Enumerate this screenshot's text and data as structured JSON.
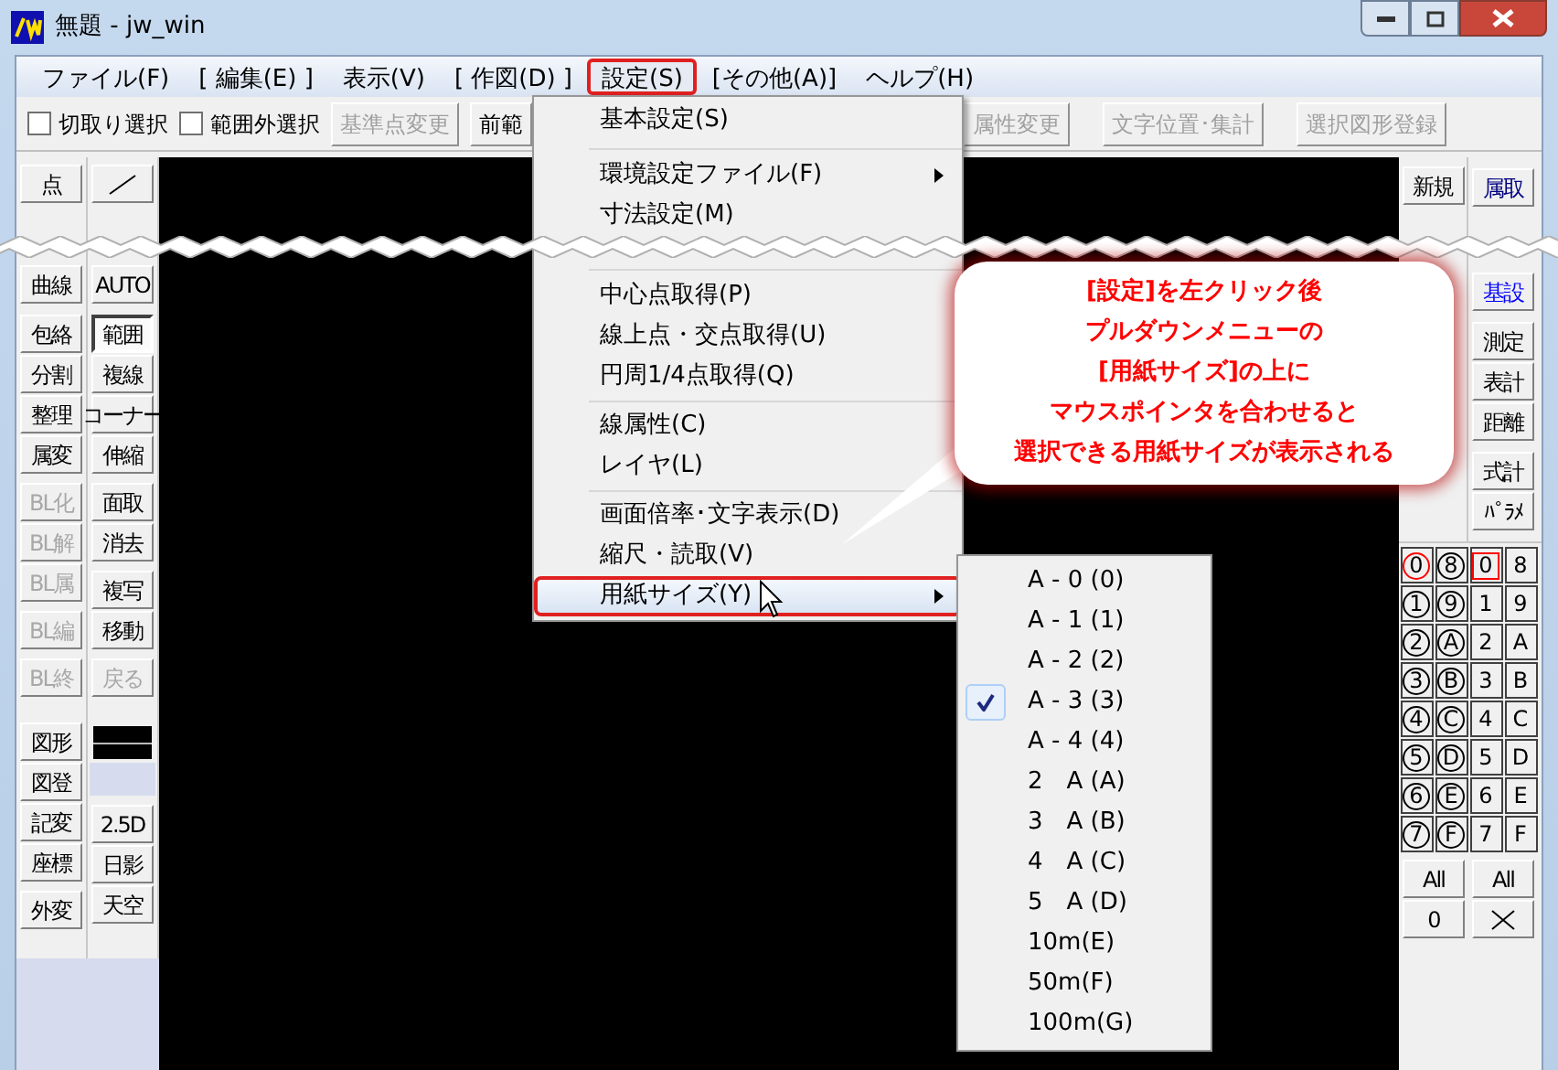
{
  "window": {
    "title": "無題 - jw_win"
  },
  "menu_bar": [
    {
      "label": "ファイル(F)",
      "selected": false
    },
    {
      "label": "[ 編集(E) ]",
      "selected": false
    },
    {
      "label": "表示(V)",
      "selected": false
    },
    {
      "label": "[ 作図(D) ]",
      "selected": false
    },
    {
      "label": "設定(S)",
      "selected": true
    },
    {
      "label": "[その他(A)]",
      "selected": false
    },
    {
      "label": "ヘルプ(H)",
      "selected": false
    }
  ],
  "toolbar": {
    "checkboxes": [
      {
        "label": "切取り選択",
        "checked": false
      },
      {
        "label": "範囲外選択",
        "checked": false
      }
    ],
    "buttons": [
      {
        "label": "基準点変更",
        "disabled": true
      },
      {
        "label": "前範",
        "disabled": false
      },
      {
        "label": "属性変更",
        "disabled": true
      },
      {
        "label": "文字位置･集計",
        "disabled": true
      },
      {
        "label": "選択図形登録",
        "disabled": true
      }
    ]
  },
  "left_panel": {
    "columns": [
      [
        [
          {
            "label": "点",
            "disabled": false,
            "pressed": false
          }
        ],
        [
          {
            "label": "曲線",
            "disabled": false,
            "pressed": false
          }
        ],
        [
          {
            "label": "包絡",
            "disabled": false,
            "pressed": false
          },
          {
            "label": "分割",
            "disabled": false,
            "pressed": false
          },
          {
            "label": "整理",
            "disabled": false,
            "pressed": false
          },
          {
            "label": "属変",
            "disabled": false,
            "pressed": false
          }
        ],
        [
          {
            "label": "BL化",
            "disabled": true,
            "pressed": false
          },
          {
            "label": "BL解",
            "disabled": true,
            "pressed": false
          },
          {
            "label": "BL属",
            "disabled": true,
            "pressed": false
          }
        ],
        [
          {
            "label": "BL編",
            "disabled": true,
            "pressed": false
          }
        ],
        [
          {
            "label": "BL終",
            "disabled": true,
            "pressed": false
          }
        ],
        [
          {
            "label": "図形",
            "disabled": false,
            "pressed": false
          },
          {
            "label": "図登",
            "disabled": false,
            "pressed": false
          },
          {
            "label": "記変",
            "disabled": false,
            "pressed": false
          },
          {
            "label": "座標",
            "disabled": false,
            "pressed": false
          }
        ],
        [
          {
            "label": "外変",
            "disabled": false,
            "pressed": false
          }
        ]
      ],
      [
        [
          {
            "kind": "line"
          }
        ],
        [
          {
            "label": "AUTO",
            "disabled": false,
            "pressed": false
          }
        ],
        [
          {
            "label": "範囲",
            "disabled": false,
            "pressed": true
          },
          {
            "label": "複線",
            "disabled": false,
            "pressed": false
          },
          {
            "label": "コーナー",
            "disabled": false,
            "pressed": false
          },
          {
            "label": "伸縮",
            "disabled": false,
            "pressed": false
          }
        ],
        [
          {
            "label": "面取",
            "disabled": false,
            "pressed": false
          },
          {
            "label": "消去",
            "disabled": false,
            "pressed": false
          }
        ],
        [
          {
            "label": "複写",
            "disabled": false,
            "pressed": false
          },
          {
            "label": "移動",
            "disabled": false,
            "pressed": false
          }
        ],
        [
          {
            "label": "戻る",
            "disabled": true,
            "pressed": false
          }
        ],
        [
          {
            "kind": "swatch"
          }
        ],
        [
          {
            "label": "2.5D",
            "disabled": false,
            "pressed": false
          },
          {
            "label": "日影",
            "disabled": false,
            "pressed": false
          },
          {
            "label": "天空",
            "disabled": false,
            "pressed": false
          }
        ]
      ]
    ]
  },
  "right_panel": {
    "column_1": [
      {
        "label": "新規",
        "color": "#000000"
      }
    ],
    "column_2": [
      {
        "label": "属取",
        "color": "#000080"
      },
      {
        "label": "基設",
        "color": "#0000ff"
      },
      {
        "label": "測定",
        "color": "#000000"
      },
      {
        "label": "表計",
        "color": "#000000"
      },
      {
        "label": "距離",
        "color": "#000000"
      },
      {
        "label": "式計",
        "color": "#000000"
      },
      {
        "label": "ﾊﾟﾗﾒ",
        "color": "#000000"
      }
    ],
    "layer_groups": [
      {
        "label": "0",
        "selected": true
      },
      {
        "label": "1",
        "selected": false
      },
      {
        "label": "2",
        "selected": false
      },
      {
        "label": "3",
        "selected": false
      },
      {
        "label": "4",
        "selected": false
      },
      {
        "label": "5",
        "selected": false
      },
      {
        "label": "6",
        "selected": false
      },
      {
        "label": "7",
        "selected": false
      },
      {
        "label": "8",
        "selected": false
      },
      {
        "label": "9",
        "selected": false
      },
      {
        "label": "A",
        "selected": false
      },
      {
        "label": "B",
        "selected": false
      },
      {
        "label": "C",
        "selected": false
      },
      {
        "label": "D",
        "selected": false
      },
      {
        "label": "E",
        "selected": false
      },
      {
        "label": "F",
        "selected": false
      }
    ],
    "layers": [
      {
        "label": "0",
        "selected": true
      },
      {
        "label": "1",
        "selected": false
      },
      {
        "label": "2",
        "selected": false
      },
      {
        "label": "3",
        "selected": false
      },
      {
        "label": "4",
        "selected": false
      },
      {
        "label": "5",
        "selected": false
      },
      {
        "label": "6",
        "selected": false
      },
      {
        "label": "7",
        "selected": false
      },
      {
        "label": "8",
        "selected": false
      },
      {
        "label": "9",
        "selected": false
      },
      {
        "label": "A",
        "selected": false
      },
      {
        "label": "B",
        "selected": false
      },
      {
        "label": "C",
        "selected": false
      },
      {
        "label": "D",
        "selected": false
      },
      {
        "label": "E",
        "selected": false
      },
      {
        "label": "F",
        "selected": false
      }
    ],
    "group_buttons": [
      "All",
      "0"
    ],
    "layer_buttons": [
      "All"
    ]
  },
  "settings_menu": [
    [
      {
        "label": "基本設定(S)",
        "submenu": false,
        "highlighted": false
      }
    ],
    [
      {
        "label": "環境設定ファイル(F)",
        "submenu": true,
        "highlighted": false
      },
      {
        "label": "寸法設定(M)",
        "submenu": false,
        "highlighted": false
      }
    ],
    [
      {
        "label": "中心点取得(P)",
        "submenu": false,
        "highlighted": false
      },
      {
        "label": "線上点・交点取得(U)",
        "submenu": false,
        "highlighted": false
      },
      {
        "label": "円周1/4点取得(Q)",
        "submenu": false,
        "highlighted": false
      }
    ],
    [
      {
        "label": "線属性(C)",
        "submenu": false,
        "highlighted": false
      },
      {
        "label": "レイヤ(L)",
        "submenu": false,
        "highlighted": false
      }
    ],
    [
      {
        "label": "画面倍率･文字表示(D)",
        "submenu": false,
        "highlighted": false
      },
      {
        "label": "縮尺・読取(V)",
        "submenu": false,
        "highlighted": false
      },
      {
        "label": "用紙サイズ(Y)",
        "submenu": true,
        "highlighted": true
      }
    ]
  ],
  "paper_size_menu": [
    {
      "label": "A - 0 (0)",
      "checked": false
    },
    {
      "label": "A - 1 (1)",
      "checked": false
    },
    {
      "label": "A - 2 (2)",
      "checked": false
    },
    {
      "label": "A - 3 (3)",
      "checked": true
    },
    {
      "label": "A - 4 (4)",
      "checked": false
    },
    {
      "label": "2　A (A)",
      "checked": false
    },
    {
      "label": "3　A (B)",
      "checked": false
    },
    {
      "label": "4　A (C)",
      "checked": false
    },
    {
      "label": "5　A (D)",
      "checked": false
    },
    {
      "label": "10m(E)",
      "checked": false
    },
    {
      "label": "50m(F)",
      "checked": false
    },
    {
      "label": "100m(G)",
      "checked": false
    }
  ],
  "callout": {
    "lines": [
      "[設定]を左クリック後",
      "プルダウンメニューの",
      "[用紙サイズ]の上に",
      "マウスポインタを合わせると",
      "選択できる用紙サイズが表示される"
    ]
  }
}
